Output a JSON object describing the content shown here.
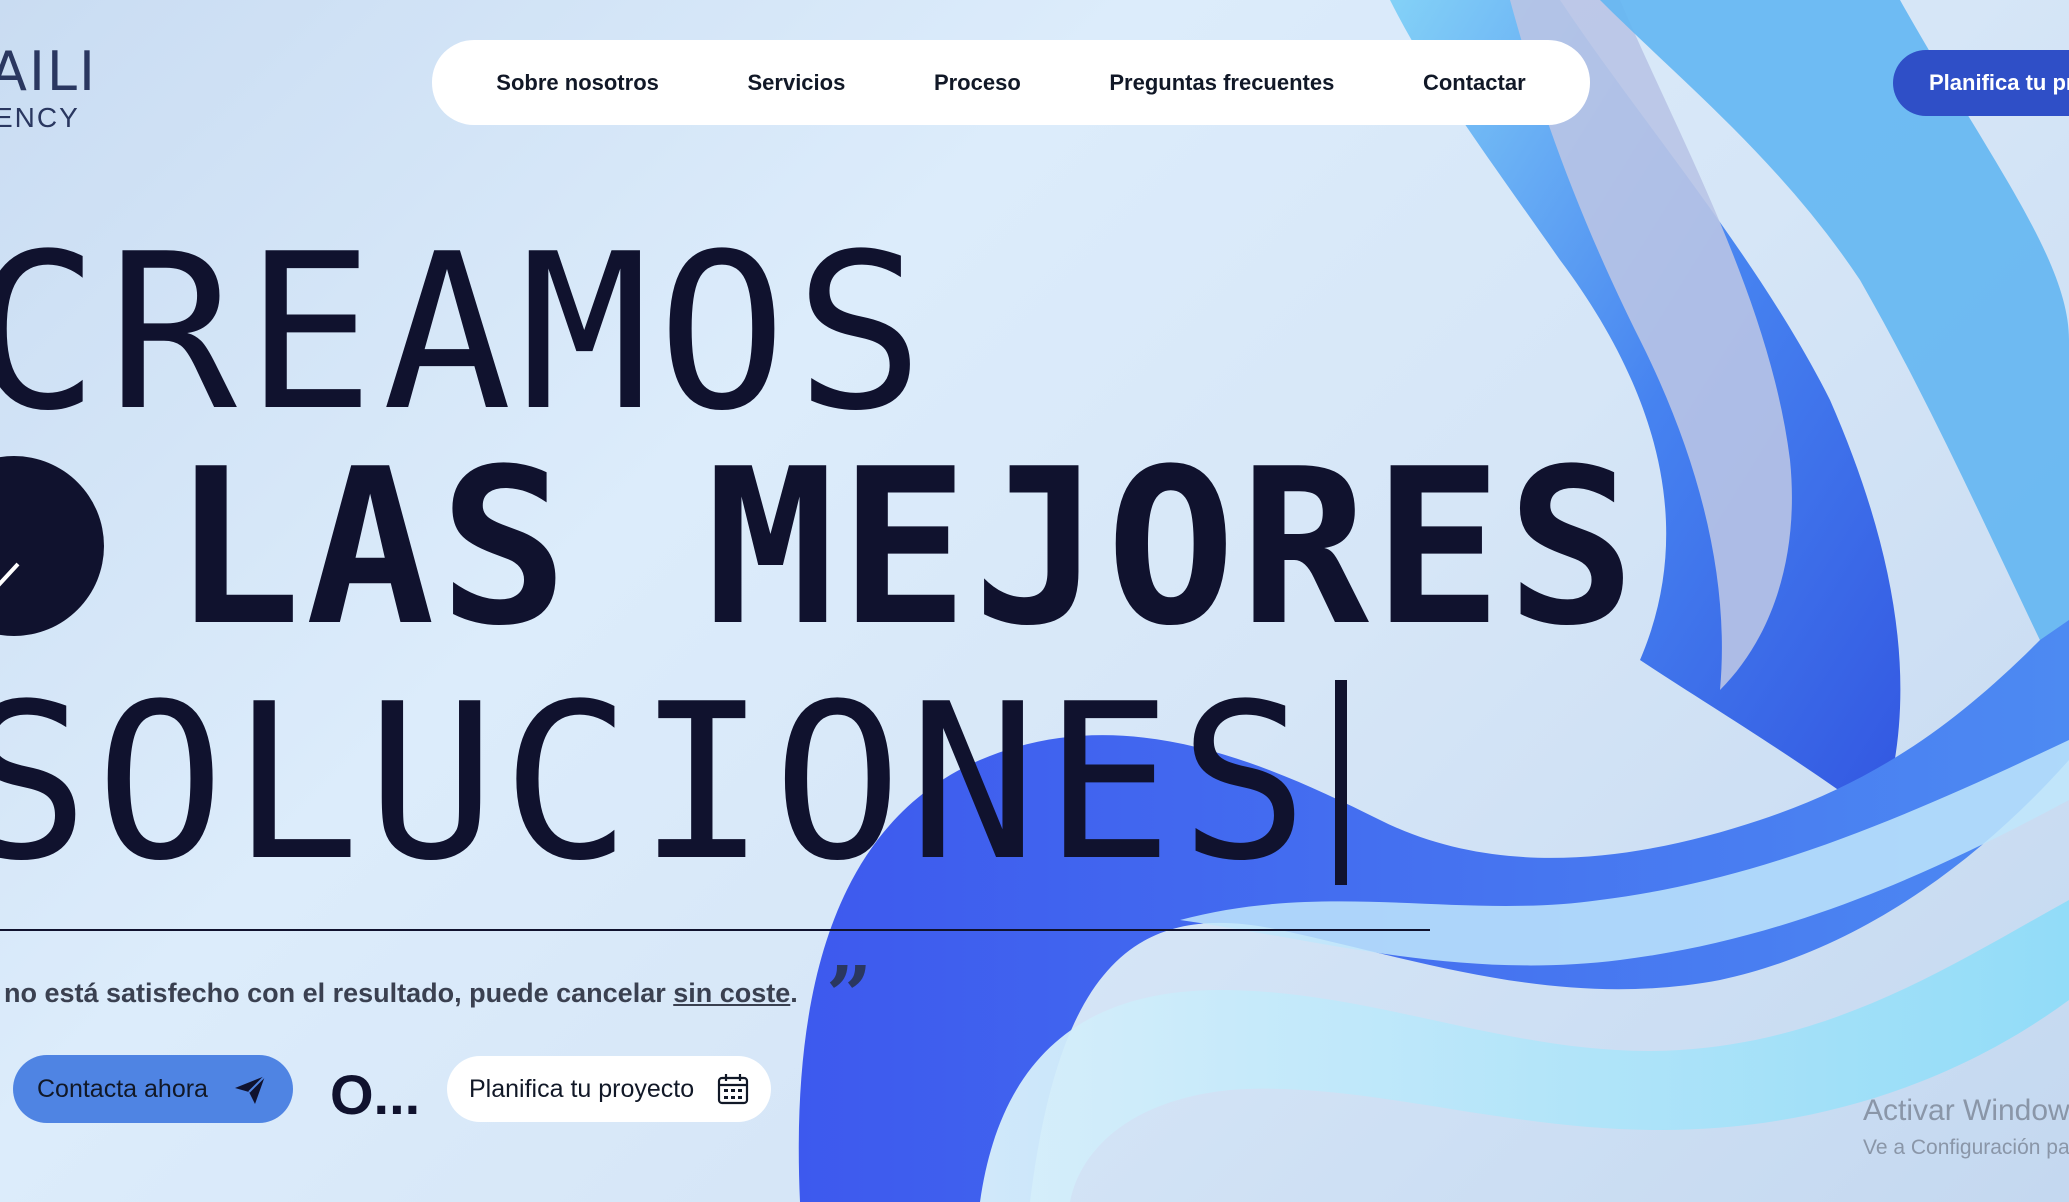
{
  "logo": {
    "mark": "AILI",
    "sub": "ENCY"
  },
  "nav": {
    "items": [
      "Sobre nosotros",
      "Servicios",
      "Proceso",
      "Preguntas frecuentes",
      "Contactar"
    ]
  },
  "header_cta": "Planifica tu pr",
  "hero": {
    "line1": "CREAMOS",
    "line2": "LAS MEJORES",
    "line3": "SOLUCIONES"
  },
  "quote": {
    "text": "no está satisfecho con el resultado, puede cancelar ",
    "link": "sin coste",
    "end": "."
  },
  "actions": {
    "contact_label": "Contacta ahora",
    "or_label": "O...",
    "plan_label": "Planifica tu proyecto"
  },
  "watermark": {
    "title": "Activar Window",
    "subtitle": "Ve a Configuración pa"
  },
  "icons": [
    "arrow-down-icon",
    "send-icon",
    "calendar-icon",
    "quote-icon"
  ],
  "colors": {
    "dark": "#10122e",
    "accent": "#2f4fc7",
    "button": "#4f84e3"
  }
}
